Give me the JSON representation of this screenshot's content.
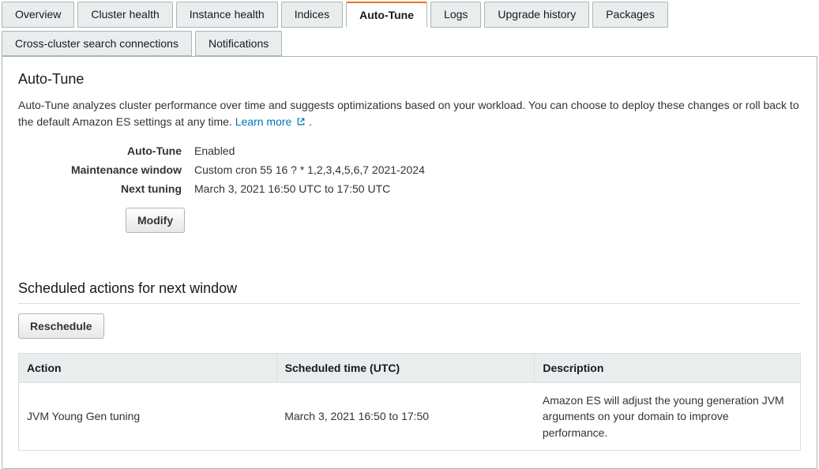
{
  "tabs_row1": [
    {
      "label": "Overview",
      "active": false
    },
    {
      "label": "Cluster health",
      "active": false
    },
    {
      "label": "Instance health",
      "active": false
    },
    {
      "label": "Indices",
      "active": false
    },
    {
      "label": "Auto-Tune",
      "active": true
    },
    {
      "label": "Logs",
      "active": false
    },
    {
      "label": "Upgrade history",
      "active": false
    },
    {
      "label": "Packages",
      "active": false
    }
  ],
  "tabs_row2": [
    {
      "label": "Cross-cluster search connections",
      "active": false
    },
    {
      "label": "Notifications",
      "active": false
    }
  ],
  "panel": {
    "title": "Auto-Tune",
    "description": "Auto-Tune analyzes cluster performance over time and suggests optimizations based on your workload. You can choose to deploy these changes or roll back to the default Amazon ES settings at any time. ",
    "learn_more": "Learn more",
    "period": "."
  },
  "kv": {
    "autotune_label": "Auto-Tune",
    "autotune_value": "Enabled",
    "mw_label": "Maintenance window",
    "mw_value": "Custom cron 55 16 ? * 1,2,3,4,5,6,7 2021-2024",
    "nt_label": "Next tuning",
    "nt_value": "March 3, 2021 16:50 UTC to 17:50 UTC"
  },
  "buttons": {
    "modify": "Modify",
    "reschedule": "Reschedule"
  },
  "scheduled": {
    "title": "Scheduled actions for next window",
    "columns": {
      "action": "Action",
      "time": "Scheduled time (UTC)",
      "desc": "Description"
    },
    "rows": [
      {
        "action": "JVM Young Gen tuning",
        "time": "March 3, 2021 16:50 to 17:50",
        "desc": "Amazon ES will adjust the young generation JVM arguments on your domain to improve performance."
      }
    ]
  }
}
